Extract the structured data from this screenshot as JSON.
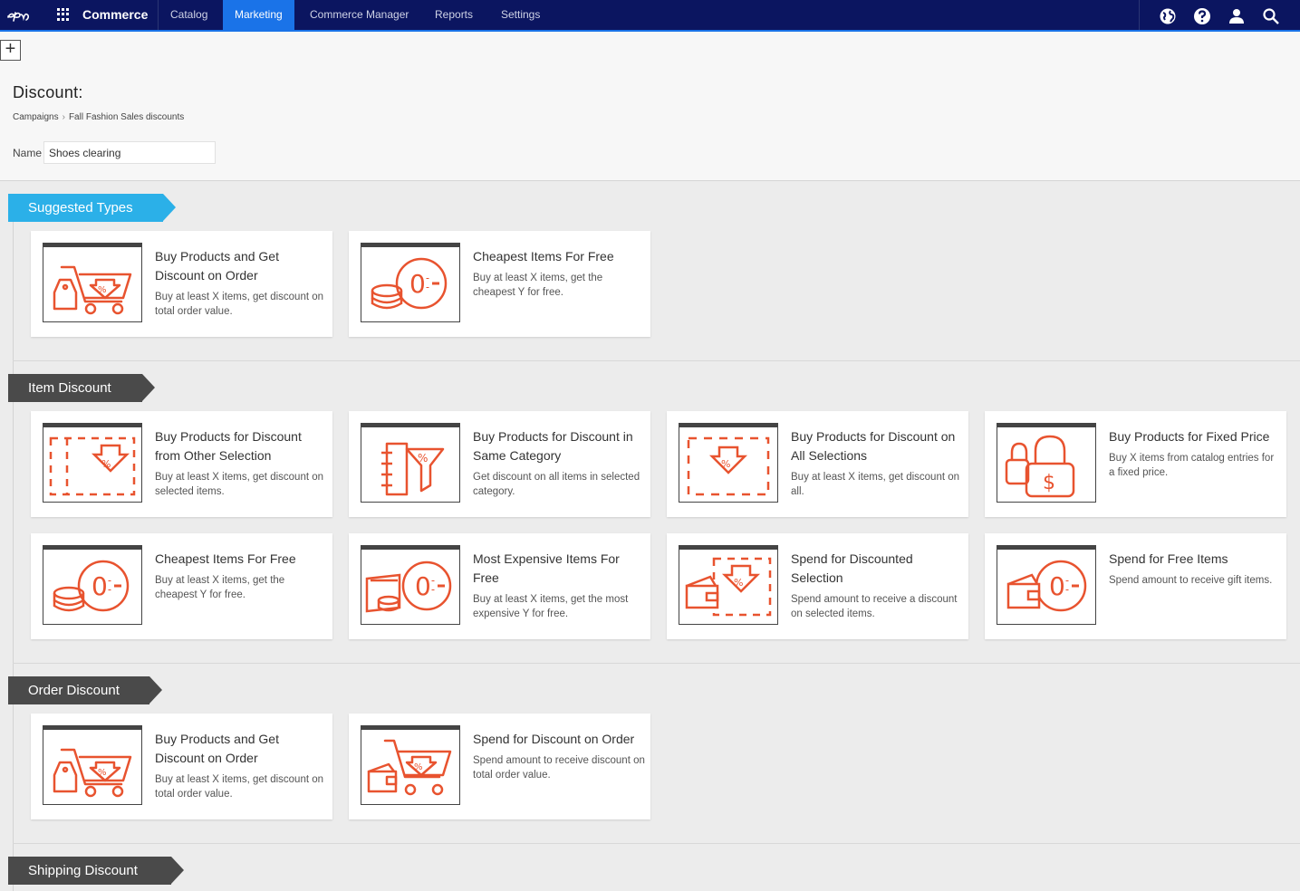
{
  "topnav": {
    "brand": "Commerce",
    "items": [
      {
        "label": "Catalog"
      },
      {
        "label": "Marketing",
        "active": true
      },
      {
        "label": "Commerce Manager"
      },
      {
        "label": "Reports"
      },
      {
        "label": "Settings"
      }
    ],
    "accent_color": "#1a73e8",
    "bar_color": "#0b1560"
  },
  "header": {
    "title": "Discount:",
    "breadcrumb": [
      "Campaigns",
      "Fall Fashion Sales discounts"
    ],
    "name_label": "Name",
    "name_value": "Shoes clearing"
  },
  "sections": [
    {
      "title": "Suggested Types",
      "style": "blue",
      "cards": [
        {
          "title": "Buy Products and Get Discount on Order",
          "desc": "Buy at least X items, get discount on total order value.",
          "icon": "cart-tag-percent-icon"
        },
        {
          "title": "Cheapest Items For Free",
          "desc": "Buy at least X items, get the cheapest Y for free.",
          "icon": "coins-zero-icon"
        }
      ]
    },
    {
      "title": "Item Discount",
      "style": "dark",
      "cards": [
        {
          "title": "Buy Products for Discount from Other Selection",
          "desc": "Buy at least X items, get discount on selected items.",
          "icon": "dashed-selection-percent-icon"
        },
        {
          "title": "Buy Products for Discount in Same Category",
          "desc": "Get discount on all items in selected category.",
          "icon": "category-funnel-percent-icon"
        },
        {
          "title": "Buy Products for Discount on All Selections",
          "desc": "Buy at least X items, get discount on all.",
          "icon": "all-selection-percent-icon"
        },
        {
          "title": "Buy Products for Fixed Price",
          "desc": "Buy X items from catalog entries for a fixed price.",
          "icon": "lock-dollar-icon"
        },
        {
          "title": "Cheapest Items For Free",
          "desc": "Buy at least X items, get the cheapest Y for free.",
          "icon": "coins-zero-icon"
        },
        {
          "title": "Most Expensive Items For Free",
          "desc": "Buy at least X items, get the most expensive Y for free.",
          "icon": "bills-zero-icon"
        },
        {
          "title": "Spend for Discounted Selection",
          "desc": "Spend amount to receive a discount on selected items.",
          "icon": "wallet-selection-icon"
        },
        {
          "title": "Spend for Free Items",
          "desc": "Spend amount to receive gift items.",
          "icon": "wallet-zero-icon"
        }
      ]
    },
    {
      "title": "Order Discount",
      "style": "dark",
      "cards": [
        {
          "title": "Buy Products and Get Discount on Order",
          "desc": "Buy at least X items, get discount on total order value.",
          "icon": "cart-tag-percent-icon"
        },
        {
          "title": "Spend for Discount on Order",
          "desc": "Spend amount to receive discount on total order value.",
          "icon": "wallet-cart-icon"
        }
      ]
    },
    {
      "title": "Shipping Discount",
      "style": "dark",
      "cards": []
    }
  ],
  "colors": {
    "icon_orange": "#e8532f",
    "ribbon_blue": "#2bb0e8",
    "ribbon_dark": "#4a4a4a"
  }
}
